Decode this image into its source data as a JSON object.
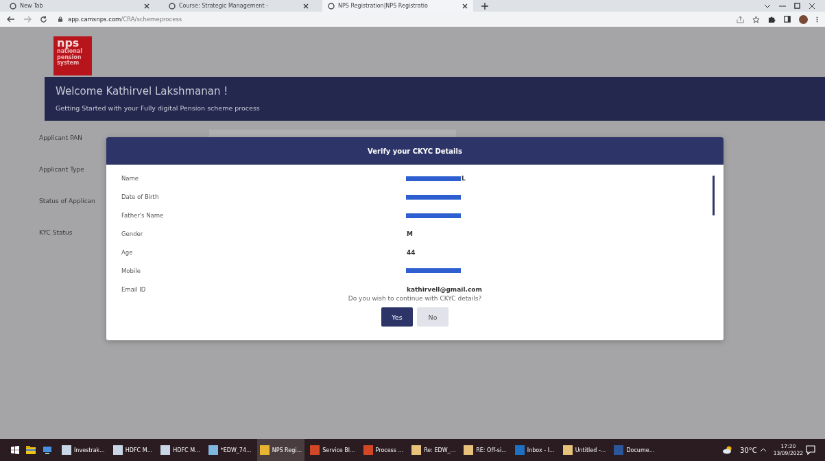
{
  "browser": {
    "tabs": [
      {
        "title": "New Tab",
        "selected": false
      },
      {
        "title": "Course: Strategic Management -",
        "selected": false
      },
      {
        "title": "NPS Registration|NPS Registratio",
        "selected": true
      }
    ],
    "address": {
      "host": "app.camsnps.com",
      "path": "/CRA/schemeprocess"
    }
  },
  "page": {
    "logo": {
      "mark": "nps",
      "lines": [
        "national",
        "pension",
        "system"
      ]
    },
    "banner": {
      "title": "Welcome Kathirvel Lakshmanan !",
      "subtitle": "Getting Started with your Fully digital Pension scheme process"
    },
    "fields": [
      "Applicant PAN",
      "Applicant Type",
      "Status of Applican",
      "KYC Status"
    ]
  },
  "dialog": {
    "title": "Verify your CKYC Details",
    "rows": [
      {
        "label": "Name",
        "value": "L",
        "redacted": true
      },
      {
        "label": "Date of Birth",
        "value": "",
        "redacted": true
      },
      {
        "label": "Father's Name",
        "value": "",
        "redacted": true
      },
      {
        "label": "Gender",
        "value": "M",
        "redacted": false
      },
      {
        "label": "Age",
        "value": "44",
        "redacted": false
      },
      {
        "label": "Mobile",
        "value": "",
        "redacted": true
      },
      {
        "label": "Email ID",
        "value": "kathirvell@gmail.com",
        "redacted": false
      }
    ],
    "question": "Do you wish to continue with CKYC details?",
    "buttons": [
      {
        "label": "Yes",
        "kind": "primary"
      },
      {
        "label": "No",
        "kind": "secondary"
      }
    ]
  },
  "taskbar": {
    "apps": [
      {
        "label": "Investrak...",
        "kind": "doc",
        "selected": false
      },
      {
        "label": "HDFC M...",
        "kind": "doc",
        "selected": false
      },
      {
        "label": "HDFC M...",
        "kind": "doc",
        "selected": false
      },
      {
        "label": "*EDW_74...",
        "kind": "note",
        "selected": false
      },
      {
        "label": "NPS Regi...",
        "kind": "browser",
        "selected": true
      },
      {
        "label": "Service Bl...",
        "kind": "slides",
        "selected": false
      },
      {
        "label": "Process ...",
        "kind": "slides",
        "selected": false
      },
      {
        "label": "Re: EDW_...",
        "kind": "mail",
        "selected": false
      },
      {
        "label": "RE: Off-si...",
        "kind": "mail",
        "selected": false
      },
      {
        "label": "Inbox - I...",
        "kind": "outlook",
        "selected": false
      },
      {
        "label": "Untitled -...",
        "kind": "mail",
        "selected": false
      },
      {
        "label": "Docume...",
        "kind": "word",
        "selected": false
      }
    ],
    "weather": "30°C",
    "time": "17:20",
    "date": "13/09/2022"
  }
}
